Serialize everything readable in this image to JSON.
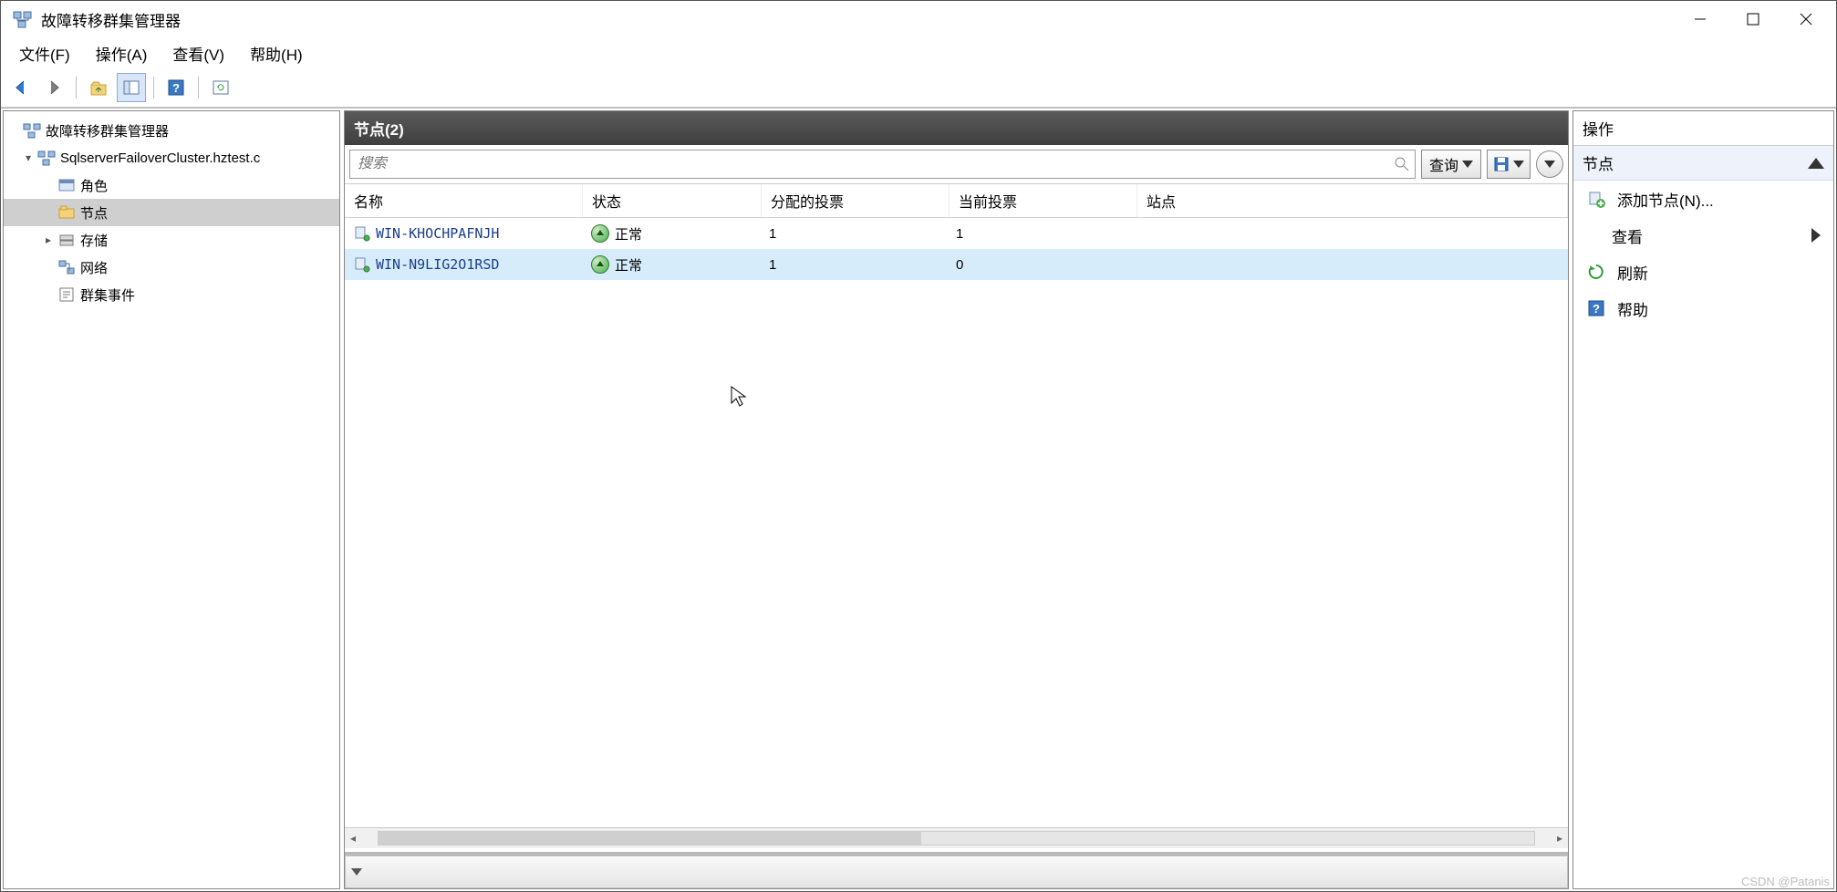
{
  "window": {
    "title": "故障转移群集管理器"
  },
  "menus": {
    "file": "文件(F)",
    "action": "操作(A)",
    "view": "查看(V)",
    "help": "帮助(H)"
  },
  "tree": {
    "root": "故障转移群集管理器",
    "cluster": "SqlserverFailoverCluster.hztest.c",
    "roles": "角色",
    "nodes": "节点",
    "storage": "存储",
    "network": "网络",
    "events": "群集事件"
  },
  "center": {
    "header": "节点(2)",
    "search_placeholder": "搜索",
    "query_btn": "查询",
    "columns": {
      "name": "名称",
      "status": "状态",
      "assigned": "分配的投票",
      "current": "当前投票",
      "site": "站点"
    },
    "rows": [
      {
        "name": "WIN-KHOCHPAFNJH",
        "status": "正常",
        "assigned": "1",
        "current": "1",
        "site": ""
      },
      {
        "name": "WIN-N9LIG2O1RSD",
        "status": "正常",
        "assigned": "1",
        "current": "0",
        "site": ""
      }
    ]
  },
  "actions": {
    "header": "操作",
    "section": "节点",
    "add_node": "添加节点(N)...",
    "view": "查看",
    "refresh": "刷新",
    "help": "帮助"
  },
  "watermark": "CSDN @Patanis"
}
